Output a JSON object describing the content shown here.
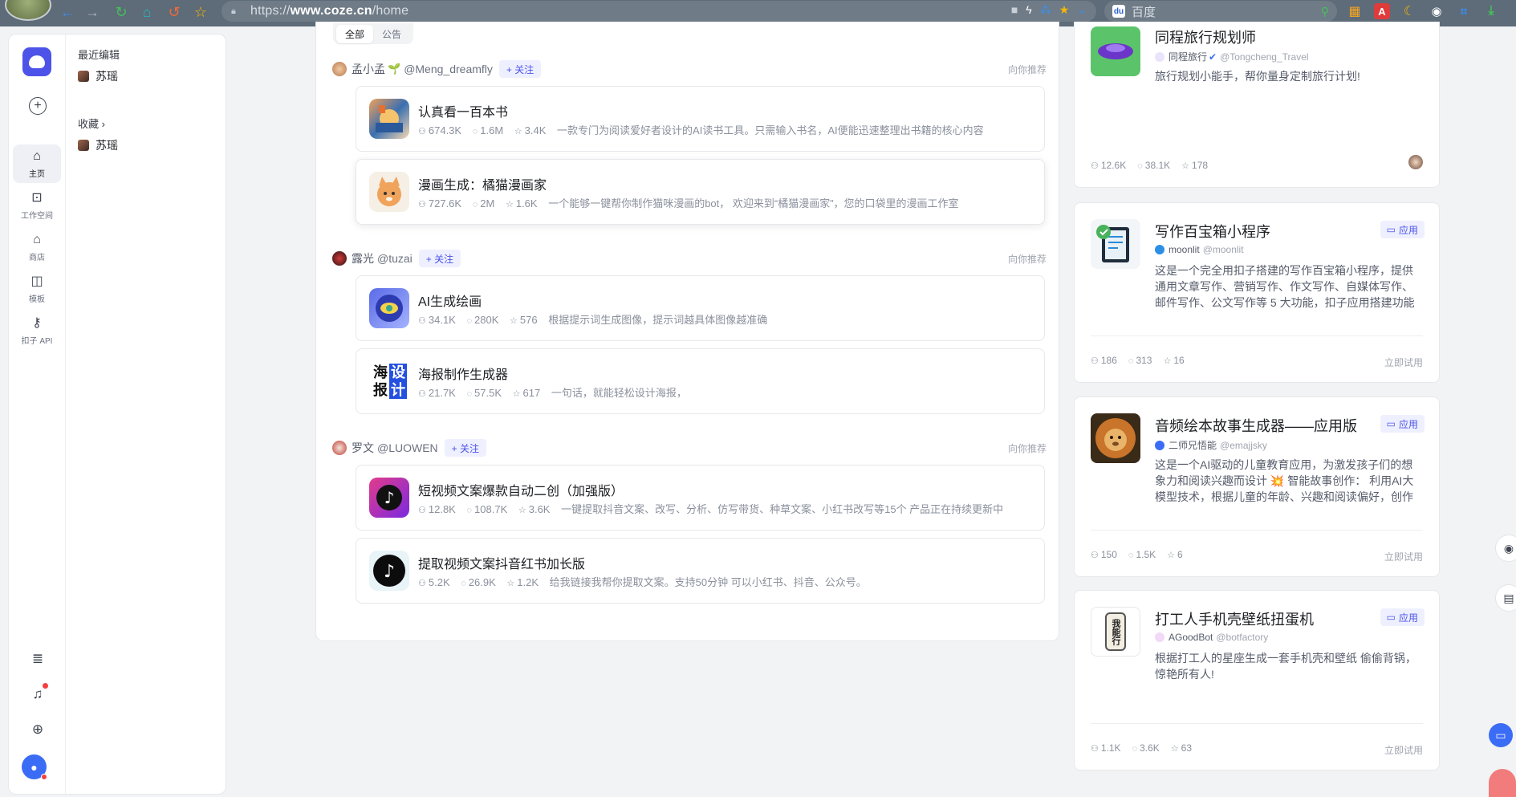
{
  "browser": {
    "url_prefix": "https://",
    "url_domain": "www.coze.cn",
    "url_path": "/home",
    "search_engine": "百度"
  },
  "rail": {
    "items": [
      {
        "label": "主页",
        "icon": "home-icon"
      },
      {
        "label": "工作空间",
        "icon": "workspace-icon"
      },
      {
        "label": "商店",
        "icon": "store-icon"
      },
      {
        "label": "模板",
        "icon": "template-icon"
      },
      {
        "label": "扣子 API",
        "icon": "api-icon"
      }
    ]
  },
  "sidebar": {
    "recent_heading": "最近编辑",
    "recent_item": "苏瑶",
    "favorites_heading": "收藏 ›",
    "favorite_item": "苏瑶"
  },
  "feed": {
    "tabs": [
      "全部",
      "公告"
    ],
    "follow_label": "+ 关注",
    "recommend_label": "向你推荐",
    "groups": [
      {
        "creator_name": "孟小孟",
        "creator_emoji": "🌱",
        "creator_handle": "@Meng_dreamfly",
        "bots": [
          {
            "title": "认真看一百本书",
            "users": "674.3K",
            "chats": "1.6M",
            "stars": "3.4K",
            "desc": "一款专门为阅读爱好者设计的AI读书工具。只需输入书名，AI便能迅速整理出书籍的核心内容"
          },
          {
            "title": "漫画生成：橘猫漫画家",
            "users": "727.6K",
            "chats": "2M",
            "stars": "1.6K",
            "desc": "一个能够一键帮你制作猫咪漫画的bot， 欢迎来到“橘猫漫画家”，您的口袋里的漫画工作室"
          }
        ]
      },
      {
        "creator_name": "露光",
        "creator_emoji": "",
        "creator_handle": "@tuzai",
        "bots": [
          {
            "title": "AI生成绘画",
            "users": "34.1K",
            "chats": "280K",
            "stars": "576",
            "desc": "根据提示词生成图像，提示词越具体图像越准确"
          },
          {
            "title": "海报制作生成器",
            "users": "21.7K",
            "chats": "57.5K",
            "stars": "617",
            "desc": "一句话，就能轻松设计海报，"
          }
        ]
      },
      {
        "creator_name": "罗文",
        "creator_emoji": "",
        "creator_handle": "@LUOWEN",
        "bots": [
          {
            "title": "短视频文案爆款自动二创（加强版）",
            "users": "12.8K",
            "chats": "108.7K",
            "stars": "3.6K",
            "desc": "一键提取抖音文案、改写、分析、仿写带货、种草文案、小红书改写等15个 产品正在持续更新中"
          },
          {
            "title": "提取视频文案抖音红书加长版",
            "users": "5.2K",
            "chats": "26.9K",
            "stars": "1.2K",
            "desc": "给我链接我帮你提取文案。支持50分钟 可以小红书、抖音、公众号。"
          }
        ]
      }
    ]
  },
  "poster_icon_text": {
    "a": "海",
    "b": "设",
    "c": "报",
    "d": "计"
  },
  "apps": [
    {
      "title": "同程旅行规划师",
      "author": "同程旅行",
      "handle": "@Tongcheng_Travel",
      "desc": "旅行规划小能手，帮你量身定制旅行计划!",
      "users": "12.6K",
      "chats": "38.1K",
      "stars": "178",
      "badge": "",
      "try": ""
    },
    {
      "title": "写作百宝箱小程序",
      "author": "moonlit",
      "handle": "@moonlit",
      "desc": "这是一个完全用扣子搭建的写作百宝箱小程序，提供通用文章写作、营销写作、作文写作、自媒体写作、邮件写作、公文写作等 5 大功能，扣子应用搭建功能非常强大",
      "users": "186",
      "chats": "313",
      "stars": "16",
      "badge": "应用",
      "try": "立即试用"
    },
    {
      "title": "音频绘本故事生成器——应用版",
      "author": "二师兄悟能",
      "handle": "@emajjsky",
      "desc": "这是一个AI驱动的儿童教育应用，为激发孩子们的想象力和阅读兴趣而设计 💥 智能故事创作： 利用AI大模型技术，根据儿童的年龄、兴趣和阅读偏好，创作个性化故事",
      "users": "150",
      "chats": "1.5K",
      "stars": "6",
      "badge": "应用",
      "try": "立即试用"
    },
    {
      "title": "打工人手机壳壁纸扭蛋机",
      "author": "AGoodBot",
      "handle": "@botfactory",
      "desc": "根据打工人的星座生成一套手机壳和壁纸 偷偷背锅，惊艳所有人!",
      "users": "1.1K",
      "chats": "3.6K",
      "stars": "63",
      "badge": "应用",
      "try": "立即试用"
    }
  ],
  "phone_case_text": "我能行",
  "colors": {
    "brand": "#4d53e8",
    "accent_blue": "#3b6cf6",
    "notify_red": "#f53f3f"
  }
}
